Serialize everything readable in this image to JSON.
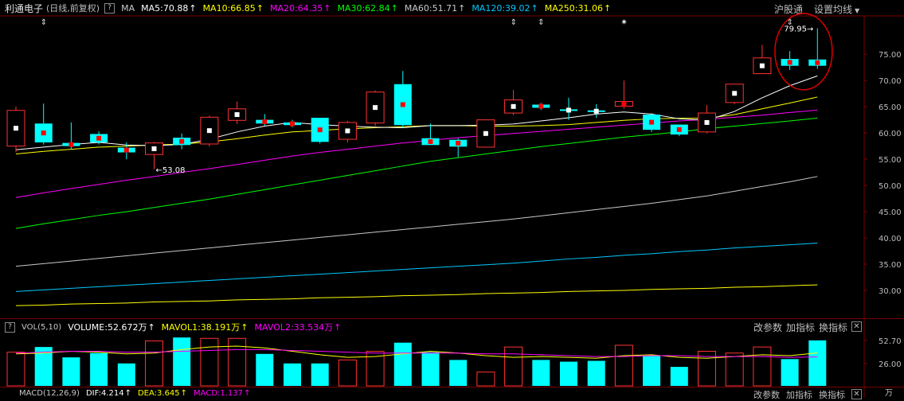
{
  "header": {
    "stock_name": "利通电子",
    "period_label": "(日线,前复权)",
    "help_label": "?",
    "ma_label": "MA",
    "ma_lines": [
      {
        "text": "MA5:70.88",
        "color": "#ffffff"
      },
      {
        "text": "MA10:66.85",
        "color": "#ffff00"
      },
      {
        "text": "MA20:64.35",
        "color": "#ff00ff"
      },
      {
        "text": "MA30:62.84",
        "color": "#00ff00"
      },
      {
        "text": "MA60:51.71",
        "color": "#c8c8c8"
      },
      {
        "text": "MA120:39.02",
        "color": "#00c8ff"
      },
      {
        "text": "MA250:31.06",
        "color": "#ffff00"
      }
    ],
    "up_arrow": "↑",
    "market_button": "沪股通",
    "settings_button": "设置均线"
  },
  "volume_header": {
    "help_label": "?",
    "label": "VOL(5,10)",
    "items": [
      {
        "text": "VOLUME:52.672万",
        "color": "#ffffff"
      },
      {
        "text": "MAVOL1:38.191万",
        "color": "#ffff00"
      },
      {
        "text": "MAVOL2:33.534万",
        "color": "#ff00ff"
      }
    ],
    "btn_params": "改参数",
    "btn_add": "加指标",
    "btn_switch": "换指标",
    "close": "✕"
  },
  "macd_header": {
    "help_label": "?",
    "label": "MACD(12,26,9)",
    "items": [
      {
        "text": "DIF:4.214",
        "color": "#ffffff"
      },
      {
        "text": "DEA:3.645",
        "color": "#ffff00"
      },
      {
        "text": "MACD:1.137",
        "color": "#ff00ff"
      }
    ],
    "btn_params": "改参数",
    "btn_add": "加指标",
    "btn_switch": "换指标",
    "close": "✕"
  },
  "chart_data": {
    "type": "candlestick",
    "ylim": [
      25,
      82
    ],
    "price_ticks": [
      "75.00",
      "70.00",
      "65.00",
      "60.00",
      "55.00",
      "50.00",
      "45.00",
      "40.00",
      "35.00",
      "30.00"
    ],
    "volume_ticks": [
      "52.70",
      "26.00",
      "万"
    ],
    "volume_ylim": [
      0,
      58
    ],
    "high_annotation": "79.95",
    "low_annotation": "53.08",
    "event_markers": [
      "⇕",
      "⇕",
      "⇕",
      "✷",
      "⇕"
    ],
    "colors": {
      "up": "#ff3232",
      "down": "#00ffff",
      "dot_red": "#ff0000",
      "dot_white": "#ffffff",
      "circle": "#dd0000"
    },
    "candles": [
      {
        "o": 57.5,
        "h": 65.0,
        "l": 56.3,
        "c": 64.3,
        "v": 39.0,
        "dot": "w"
      },
      {
        "o": 61.8,
        "h": 65.6,
        "l": 57.8,
        "c": 58.2,
        "v": 45.0,
        "dot": "r"
      },
      {
        "o": 58.1,
        "h": 62.0,
        "l": 56.8,
        "c": 57.5,
        "v": 33.0,
        "dot": "r"
      },
      {
        "o": 59.8,
        "h": 60.3,
        "l": 57.8,
        "c": 58.2,
        "v": 38.0,
        "dot": "r"
      },
      {
        "o": 57.2,
        "h": 58.2,
        "l": 55.0,
        "c": 56.3,
        "v": 26.0,
        "dot": "r"
      },
      {
        "o": 55.9,
        "h": 58.3,
        "l": 53.08,
        "c": 58.1,
        "v": 52.0,
        "dot": "w"
      },
      {
        "o": 59.1,
        "h": 59.9,
        "l": 56.9,
        "c": 57.7,
        "v": 56.0,
        "dot": "r"
      },
      {
        "o": 57.9,
        "h": 63.3,
        "l": 57.4,
        "c": 63.0,
        "v": 55.0,
        "dot": "w"
      },
      {
        "o": 62.4,
        "h": 66.0,
        "l": 61.7,
        "c": 64.6,
        "v": 55.0,
        "dot": "w"
      },
      {
        "o": 62.5,
        "h": 63.6,
        "l": 61.4,
        "c": 61.8,
        "v": 37.0,
        "dot": "r"
      },
      {
        "o": 62.0,
        "h": 62.5,
        "l": 61.1,
        "c": 61.5,
        "v": 26.0,
        "dot": "r"
      },
      {
        "o": 62.9,
        "h": 62.9,
        "l": 58.0,
        "c": 58.3,
        "v": 26.0,
        "dot": "r"
      },
      {
        "o": 58.8,
        "h": 62.3,
        "l": 58.2,
        "c": 62.0,
        "v": 30.0,
        "dot": "w"
      },
      {
        "o": 61.9,
        "h": 68.1,
        "l": 61.3,
        "c": 67.8,
        "v": 40.0,
        "dot": "w"
      },
      {
        "o": 69.3,
        "h": 71.8,
        "l": 61.0,
        "c": 61.5,
        "v": 50.0,
        "dot": "r"
      },
      {
        "o": 59.0,
        "h": 61.8,
        "l": 57.7,
        "c": 57.7,
        "v": 39.0,
        "dot": "r"
      },
      {
        "o": 58.7,
        "h": 59.0,
        "l": 55.4,
        "c": 57.4,
        "v": 30.0,
        "dot": "r"
      },
      {
        "o": 57.3,
        "h": 62.6,
        "l": 57.3,
        "c": 62.5,
        "v": 16.0,
        "dot": "w"
      },
      {
        "o": 63.8,
        "h": 68.2,
        "l": 63.4,
        "c": 66.3,
        "v": 45.0,
        "dot": "w"
      },
      {
        "o": 65.4,
        "h": 65.7,
        "l": 64.4,
        "c": 64.8,
        "v": 30.0,
        "dot": "r"
      },
      {
        "o": 64.5,
        "h": 66.7,
        "l": 62.5,
        "c": 64.5,
        "v": 28.0,
        "dot": "w"
      },
      {
        "o": 64.3,
        "h": 65.5,
        "l": 62.9,
        "c": 64.3,
        "v": 29.0,
        "dot": "w"
      },
      {
        "o": 65.1,
        "h": 70.0,
        "l": 64.6,
        "c": 66.0,
        "v": 47.0,
        "dot": "r"
      },
      {
        "o": 63.5,
        "h": 63.8,
        "l": 60.2,
        "c": 60.6,
        "v": 35.0,
        "dot": "r"
      },
      {
        "o": 61.6,
        "h": 61.6,
        "l": 59.4,
        "c": 59.7,
        "v": 22.0,
        "dot": "r"
      },
      {
        "o": 60.2,
        "h": 65.3,
        "l": 59.9,
        "c": 63.8,
        "v": 40.0,
        "dot": "w"
      },
      {
        "o": 65.8,
        "h": 69.3,
        "l": 65.5,
        "c": 69.3,
        "v": 38.0,
        "dot": "w"
      },
      {
        "o": 71.3,
        "h": 76.8,
        "l": 71.3,
        "c": 74.3,
        "v": 45.0,
        "dot": "w"
      },
      {
        "o": 74.1,
        "h": 75.6,
        "l": 72.0,
        "c": 72.8,
        "v": 31.0,
        "dot": "r"
      },
      {
        "o": 74.0,
        "h": 79.95,
        "l": 72.2,
        "c": 72.8,
        "v": 52.672,
        "dot": "r"
      }
    ],
    "candle_styles": [
      "u",
      "d",
      "d",
      "d",
      "d",
      "u",
      "d",
      "u",
      "u",
      "d",
      "d",
      "d",
      "u",
      "u",
      "d",
      "d",
      "d",
      "u",
      "u",
      "d",
      "d",
      "d",
      "u",
      "d",
      "d",
      "u",
      "u",
      "u",
      "d",
      "d"
    ],
    "ma_series": [
      {
        "name": "MA5",
        "color": "#ffffff",
        "values": [
          56.8,
          57.3,
          57.8,
          58.2,
          57.7,
          57.6,
          57.8,
          58.8,
          60.2,
          61.3,
          62.0,
          61.6,
          61.3,
          61.1,
          61.0,
          61.4,
          61.4,
          61.5,
          61.7,
          62.3,
          62.9,
          63.6,
          64.0,
          63.6,
          62.7,
          62.4,
          64.1,
          66.7,
          69.0,
          70.88
        ]
      },
      {
        "name": "MA10",
        "color": "#ffff00",
        "values": [
          56.0,
          56.5,
          56.9,
          57.3,
          57.5,
          57.7,
          57.9,
          58.3,
          58.9,
          59.6,
          60.2,
          60.5,
          60.8,
          61.0,
          61.2,
          61.4,
          61.4,
          61.3,
          61.3,
          61.4,
          61.6,
          62.0,
          62.4,
          62.7,
          62.8,
          62.8,
          63.5,
          64.6,
          65.7,
          66.85
        ]
      },
      {
        "name": "MA20",
        "color": "#ff00ff",
        "values": [
          47.7,
          48.6,
          49.4,
          50.2,
          51.0,
          51.7,
          52.5,
          53.2,
          54.0,
          54.8,
          55.6,
          56.3,
          56.9,
          57.5,
          58.1,
          58.6,
          59.1,
          59.5,
          59.9,
          60.3,
          60.7,
          61.1,
          61.5,
          61.9,
          62.3,
          62.6,
          63.0,
          63.4,
          63.9,
          64.35
        ]
      },
      {
        "name": "MA30",
        "color": "#00ff00",
        "values": [
          41.8,
          42.7,
          43.5,
          44.3,
          45.0,
          45.8,
          46.6,
          47.4,
          48.3,
          49.2,
          50.1,
          51.0,
          51.9,
          52.8,
          53.7,
          54.6,
          55.3,
          56.0,
          56.7,
          57.4,
          58.0,
          58.6,
          59.2,
          59.7,
          60.2,
          60.8,
          61.3,
          61.8,
          62.3,
          62.84
        ]
      },
      {
        "name": "MA60",
        "color": "#c8c8c8",
        "values": [
          34.6,
          35.1,
          35.6,
          36.1,
          36.6,
          37.1,
          37.6,
          38.1,
          38.6,
          39.1,
          39.6,
          40.1,
          40.6,
          41.1,
          41.6,
          42.1,
          42.6,
          43.1,
          43.6,
          44.2,
          44.8,
          45.4,
          46.0,
          46.6,
          47.3,
          48.0,
          48.9,
          49.8,
          50.7,
          51.71
        ]
      },
      {
        "name": "MA120",
        "color": "#00c8ff",
        "values": [
          29.8,
          30.1,
          30.4,
          30.7,
          31.0,
          31.3,
          31.6,
          31.9,
          32.2,
          32.5,
          32.8,
          33.1,
          33.4,
          33.7,
          34.0,
          34.3,
          34.6,
          34.9,
          35.2,
          35.6,
          36.0,
          36.3,
          36.7,
          37.0,
          37.4,
          37.7,
          38.1,
          38.4,
          38.7,
          39.02
        ]
      },
      {
        "name": "MA250",
        "color": "#ffff00",
        "values": [
          27.1,
          27.2,
          27.4,
          27.5,
          27.6,
          27.8,
          27.9,
          28.0,
          28.2,
          28.3,
          28.4,
          28.6,
          28.7,
          28.8,
          29.0,
          29.1,
          29.2,
          29.4,
          29.5,
          29.6,
          29.8,
          29.9,
          30.0,
          30.2,
          30.3,
          30.4,
          30.6,
          30.7,
          30.9,
          31.06
        ]
      }
    ],
    "vol_ma": [
      {
        "name": "MAVOL1",
        "color": "#ffff00",
        "values": [
          37,
          38,
          40,
          39,
          37,
          38,
          42,
          45,
          46,
          44,
          40,
          36,
          33,
          34,
          37,
          40,
          38,
          35,
          33,
          34,
          33,
          32,
          35,
          36,
          33,
          32,
          34,
          36,
          35,
          38.191
        ]
      },
      {
        "name": "MAVOL2",
        "color": "#ff00ff",
        "values": [
          38,
          39,
          40,
          40,
          39,
          39,
          40,
          41,
          42,
          42,
          41,
          40,
          39,
          38,
          38,
          38,
          38,
          37,
          37,
          36,
          35,
          34,
          34,
          35,
          35,
          34,
          34,
          34,
          33,
          33.534
        ]
      }
    ]
  }
}
